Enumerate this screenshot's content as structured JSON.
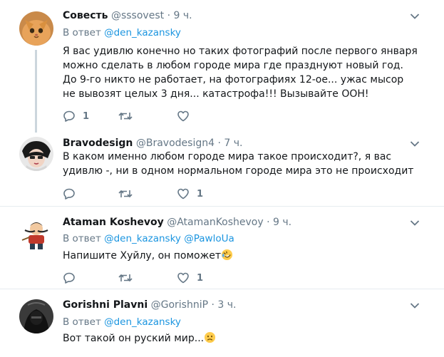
{
  "tweets": [
    {
      "name": "Совесть",
      "handle": "@sssovest",
      "dot": "·",
      "time": "9 ч.",
      "reply_prefix": "В ответ",
      "reply_mentions": [
        "@den_kazansky"
      ],
      "text": "Я вас удивлю конечно но таких фотографий после первого января можно сделать в любом городе мира где празднуют новый год. До 9-го никто не работает, на фотографиях 12-ое... ужас мысор не вывозят целых 3 дня... катастрофа!!! Вызывайте ООН!",
      "reply_count": "1",
      "retweet_count": "",
      "like_count": ""
    },
    {
      "name": "Bravodesign",
      "handle": "@Bravodesign4",
      "dot": "·",
      "time": "7 ч.",
      "text": "В каком именно любом городе мира такое происходит?, я вас удивлю -, ни в одном нормальном городе мира это не происходит",
      "reply_count": "",
      "retweet_count": "",
      "like_count": "1"
    },
    {
      "name": "Ataman Koshevoy",
      "handle": "@AtamanKoshevoy",
      "dot": "·",
      "time": "9 ч.",
      "reply_prefix": "В ответ",
      "reply_mentions": [
        "@den_kazansky",
        "@PawloUa"
      ],
      "text": "Напишите Хуйлу, он поможет",
      "emoji": "rolling-on-floor-laughing",
      "reply_count": "",
      "retweet_count": "",
      "like_count": "1"
    },
    {
      "name": "Gorishni Plavni",
      "handle": "@GorishniP",
      "dot": "·",
      "time": "3 ч.",
      "reply_prefix": "В ответ",
      "reply_mentions": [
        "@den_kazansky"
      ],
      "text": "Вот такой он руский мир...",
      "emoji": "frowning-face"
    }
  ],
  "icons": {
    "reply": "reply-icon",
    "retweet": "retweet-icon",
    "like": "heart-icon",
    "menu": "chevron-down-icon"
  },
  "colors": {
    "link": "#1b95e0",
    "muted": "#657786",
    "divider": "#e6ecf0",
    "thread_line": "#ccd6dd"
  }
}
